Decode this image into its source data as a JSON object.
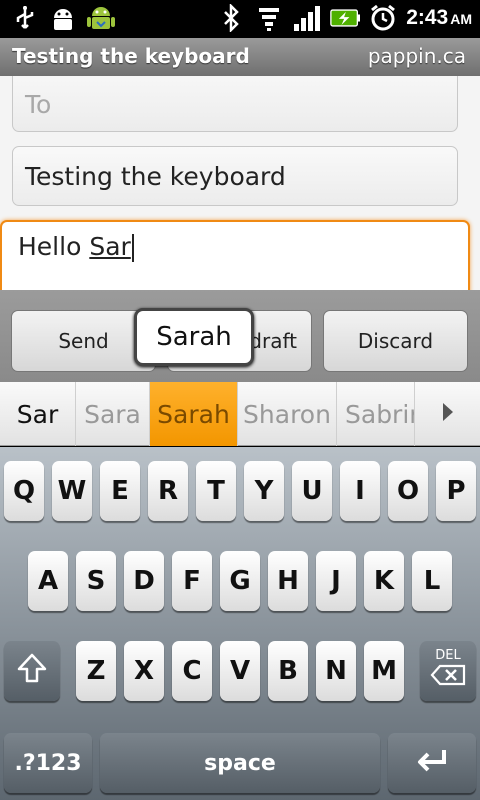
{
  "status_bar": {
    "icons_left": [
      "usb-icon",
      "android-debug-icon",
      "android-robot-icon"
    ],
    "icons_right": [
      "bluetooth-icon",
      "wifi-icon",
      "signal-icon",
      "battery-charging-icon",
      "alarm-icon"
    ],
    "time": "2:43",
    "ampm": "AM"
  },
  "title_bar": {
    "title": "Testing the keyboard",
    "account": "pappin.ca"
  },
  "compose": {
    "to_placeholder": "To",
    "subject": "Testing the keyboard",
    "body_prefix": "Hello ",
    "body_composing": "Sar"
  },
  "buttons": {
    "send": "Send",
    "save_draft": "draft",
    "discard": "Discard"
  },
  "preview_popup": "Sarah",
  "suggestions": {
    "typed": "Sar",
    "items": [
      "Sara",
      "Sarah",
      "Sharon",
      "Sabrina"
    ],
    "selected_index": 1,
    "more_icon": "chevron-right-icon"
  },
  "keyboard": {
    "row1": [
      "Q",
      "W",
      "E",
      "R",
      "T",
      "Y",
      "U",
      "I",
      "O",
      "P"
    ],
    "row2": [
      "A",
      "S",
      "D",
      "F",
      "G",
      "H",
      "J",
      "K",
      "L"
    ],
    "row3": [
      "Z",
      "X",
      "C",
      "V",
      "B",
      "N",
      "M"
    ],
    "symbols_label": ".?123",
    "space_label": "space",
    "delete_label": "DEL",
    "shift_icon": "shift-arrow-icon",
    "enter_icon": "enter-return-icon"
  },
  "colors": {
    "accent_orange": "#f39600",
    "focus_border": "#f08a14"
  }
}
